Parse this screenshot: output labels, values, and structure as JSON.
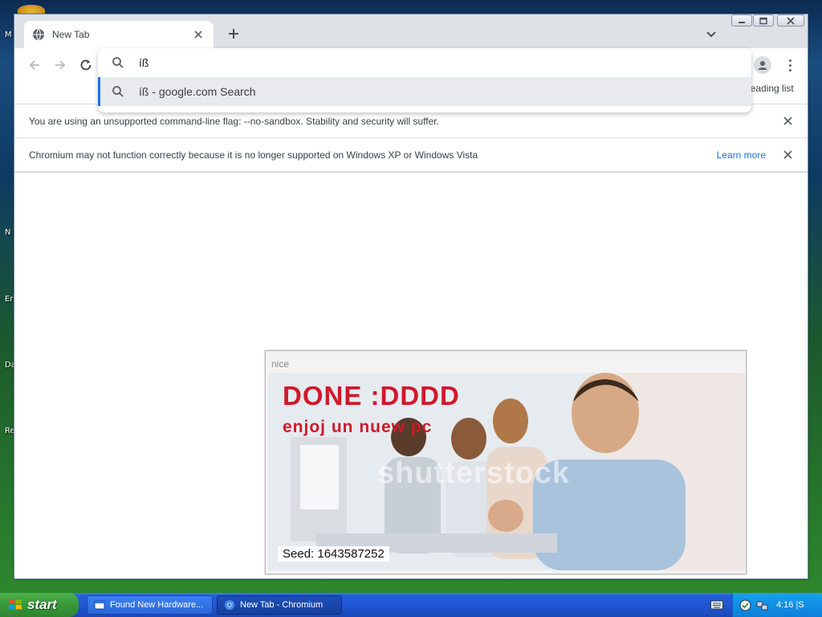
{
  "desktop": {
    "labels": [
      "M",
      "N",
      "Er",
      "Da",
      "Re"
    ]
  },
  "browser": {
    "tab": {
      "title": "New Tab"
    },
    "omnibox": {
      "query": "íß",
      "suggestion": "íß - google.com Search"
    },
    "reading_list_label": "Reading list",
    "infobars": [
      {
        "text": "You are using an unsupported command-line flag: --no-sandbox. Stability and security will suffer."
      },
      {
        "text": "Chromium may not function correctly because it is no longer supported on Windows XP or Windows Vista",
        "link": "Learn more"
      }
    ]
  },
  "popup": {
    "title": "nice",
    "headline": "DONE :DDDD",
    "subline": "enjoj un nuew pc",
    "watermark": "shutterstock",
    "seed": "Seed: 1643587252"
  },
  "taskbar": {
    "start_label": "start",
    "tasks": [
      {
        "label": "Found New Hardware..."
      },
      {
        "label": "New Tab - Chromium"
      }
    ],
    "clock": "4:16 |S"
  },
  "colors": {
    "accent": "#1a73e8",
    "warning_text": "#d0192b",
    "xp_taskbar": "#245edb",
    "xp_start": "#3a9a3a"
  },
  "icons": [
    "globe-icon",
    "close-icon",
    "plus-icon",
    "chevron-down-icon",
    "back-arrow-icon",
    "forward-arrow-icon",
    "reload-icon",
    "search-icon",
    "profile-icon",
    "kebab-menu-icon",
    "windows-flag-icon",
    "keyboard-icon",
    "network-icon",
    "security-shield-icon"
  ]
}
